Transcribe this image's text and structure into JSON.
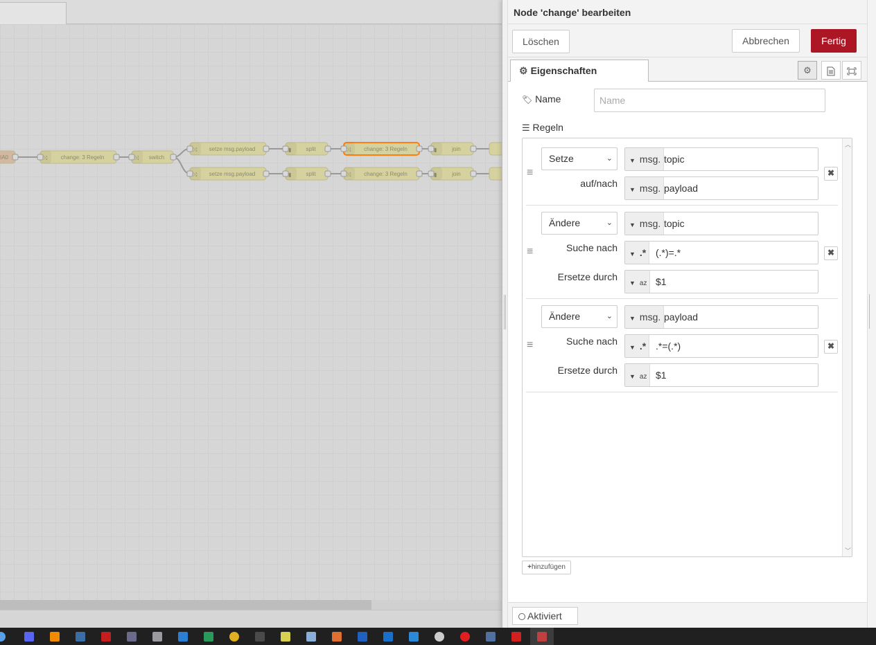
{
  "tray": {
    "title": "Node 'change' bearbeiten",
    "delete_label": "Löschen",
    "cancel_label": "Abbrechen",
    "done_label": "Fertig",
    "tab_properties": "Eigenschaften",
    "name_label": "Name",
    "name_placeholder": "Name",
    "name_value": "",
    "rules_label": "Regeln",
    "add_label": "hinzufügen",
    "enabled_label": "Aktiviert"
  },
  "rules": [
    {
      "action": "Setze",
      "rows": [
        {
          "label": "",
          "type": "msg.",
          "value": "topic"
        },
        {
          "label": "auf/nach",
          "type": "msg.",
          "value": "payload"
        }
      ]
    },
    {
      "action": "Ändere",
      "rows": [
        {
          "label": "",
          "type": "msg.",
          "value": "topic"
        },
        {
          "label": "Suche nach",
          "type": ".*",
          "value": "(.*)=.*"
        },
        {
          "label": "Ersetze durch",
          "type": "az",
          "value": "$1"
        }
      ]
    },
    {
      "action": "Ändere",
      "rows": [
        {
          "label": "",
          "type": "msg.",
          "value": "payload"
        },
        {
          "label": "Suche nach",
          "type": ".*",
          "value": ".*=(.*)"
        },
        {
          "label": "Ersetze durch",
          "type": "az",
          "value": "$1"
        }
      ]
    }
  ],
  "flow": {
    "nodes": [
      {
        "label": "IA0"
      },
      {
        "label": "change: 3 Regeln"
      },
      {
        "label": "switch"
      },
      {
        "label": "setze msg.payload"
      },
      {
        "label": "split"
      },
      {
        "label": "change: 3 Regeln",
        "selected": true
      },
      {
        "label": "join"
      },
      {
        "label": "setze msg.payload"
      },
      {
        "label": "split"
      },
      {
        "label": "change: 3 Regeln"
      },
      {
        "label": "join"
      }
    ],
    "colors": {
      "function_node": "#d6d2a0",
      "input_node": "#d2b8a0",
      "selected_border": "#ff7f0e",
      "wire": "#999999"
    }
  },
  "taskbar": {
    "icons": [
      "settings-app",
      "discord",
      "vlc",
      "network-tool",
      "filezilla",
      "calculator",
      "file-tool",
      "gear",
      "tool",
      "chrome",
      "monitor",
      "notepad",
      "editor",
      "firefox-like",
      "nextcloud",
      "outlook",
      "vscode",
      "clock",
      "opera",
      "password-manager",
      "acrobat",
      "node-red"
    ]
  },
  "theme": {
    "accent": "#ad1625",
    "panel": "#f3f3f3"
  }
}
